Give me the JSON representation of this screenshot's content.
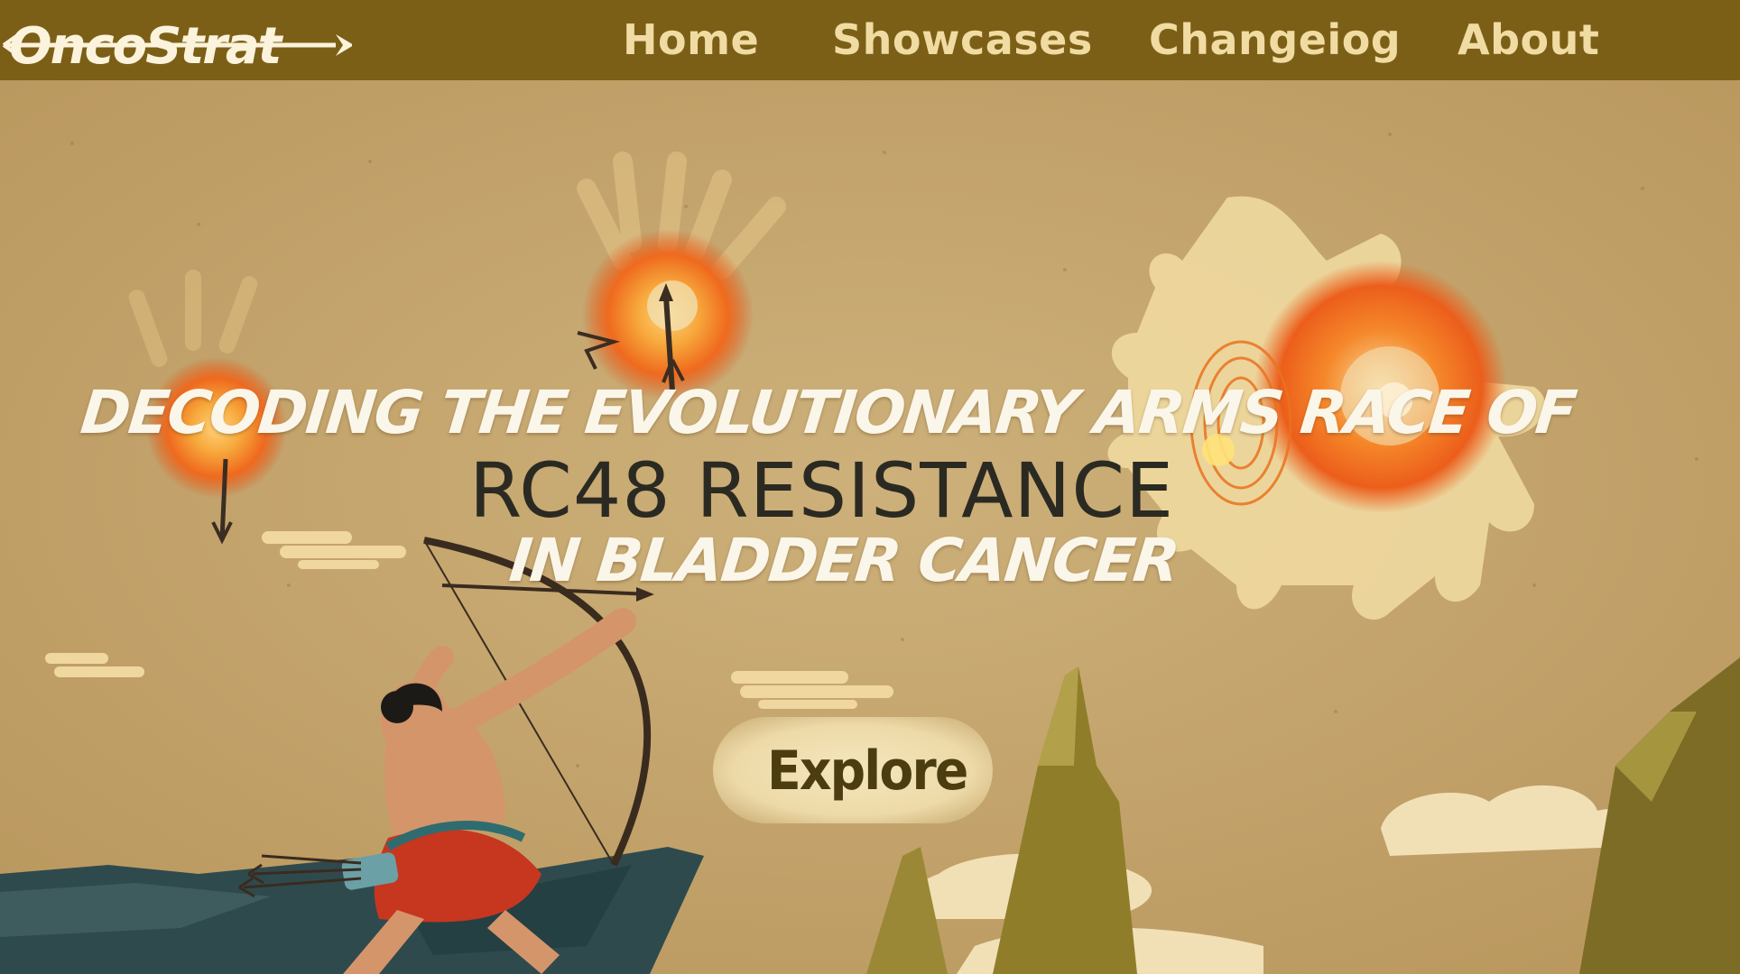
{
  "app": {
    "logo_text": "OncoStrat"
  },
  "nav": {
    "items": [
      {
        "label": "Home"
      },
      {
        "label": "Showcases"
      },
      {
        "label": "Changeiog"
      },
      {
        "label": "About"
      }
    ]
  },
  "hero": {
    "headline_line1": "DECODING THE EVOLUTIONARY ARMS RACE OF",
    "headline_line2": "RC48 RESISTANCE",
    "headline_line3": "IN BLADDER CANCER",
    "cta_label": "Explore"
  },
  "colors": {
    "nav_bg": "#7c5f17",
    "nav_text": "#f0dca3",
    "paper_bg": "#c3a36a",
    "accent_orange": "#f06a1c",
    "headline_white": "#fbf6ea",
    "headline_dark": "#2b2a22",
    "button_text": "#4b3d10"
  },
  "icons": [
    "arrow-logo-icon",
    "tumor-cell-icon",
    "arrow-icon",
    "archer-illustration",
    "cloud-icon",
    "mountain-icon"
  ]
}
